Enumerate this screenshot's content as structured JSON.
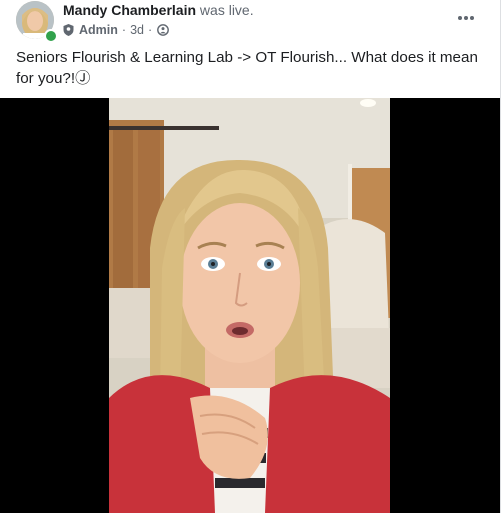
{
  "post": {
    "author": "Mandy Chamberlain",
    "action": "was live.",
    "role": "Admin",
    "separator": "·",
    "time": "3d",
    "icons": {
      "role": "shield-icon",
      "audience": "group-audience-icon",
      "more": "more-options-icon",
      "presence": "online-status-dot"
    },
    "text": "Seniors Flourish & Learning Lab -> OT Flourish... What does it mean for you?!Ⓙ"
  },
  "colors": {
    "name": "#1c1e21",
    "meta": "#606770",
    "online": "#31a24c",
    "video_bg": "#000000"
  }
}
